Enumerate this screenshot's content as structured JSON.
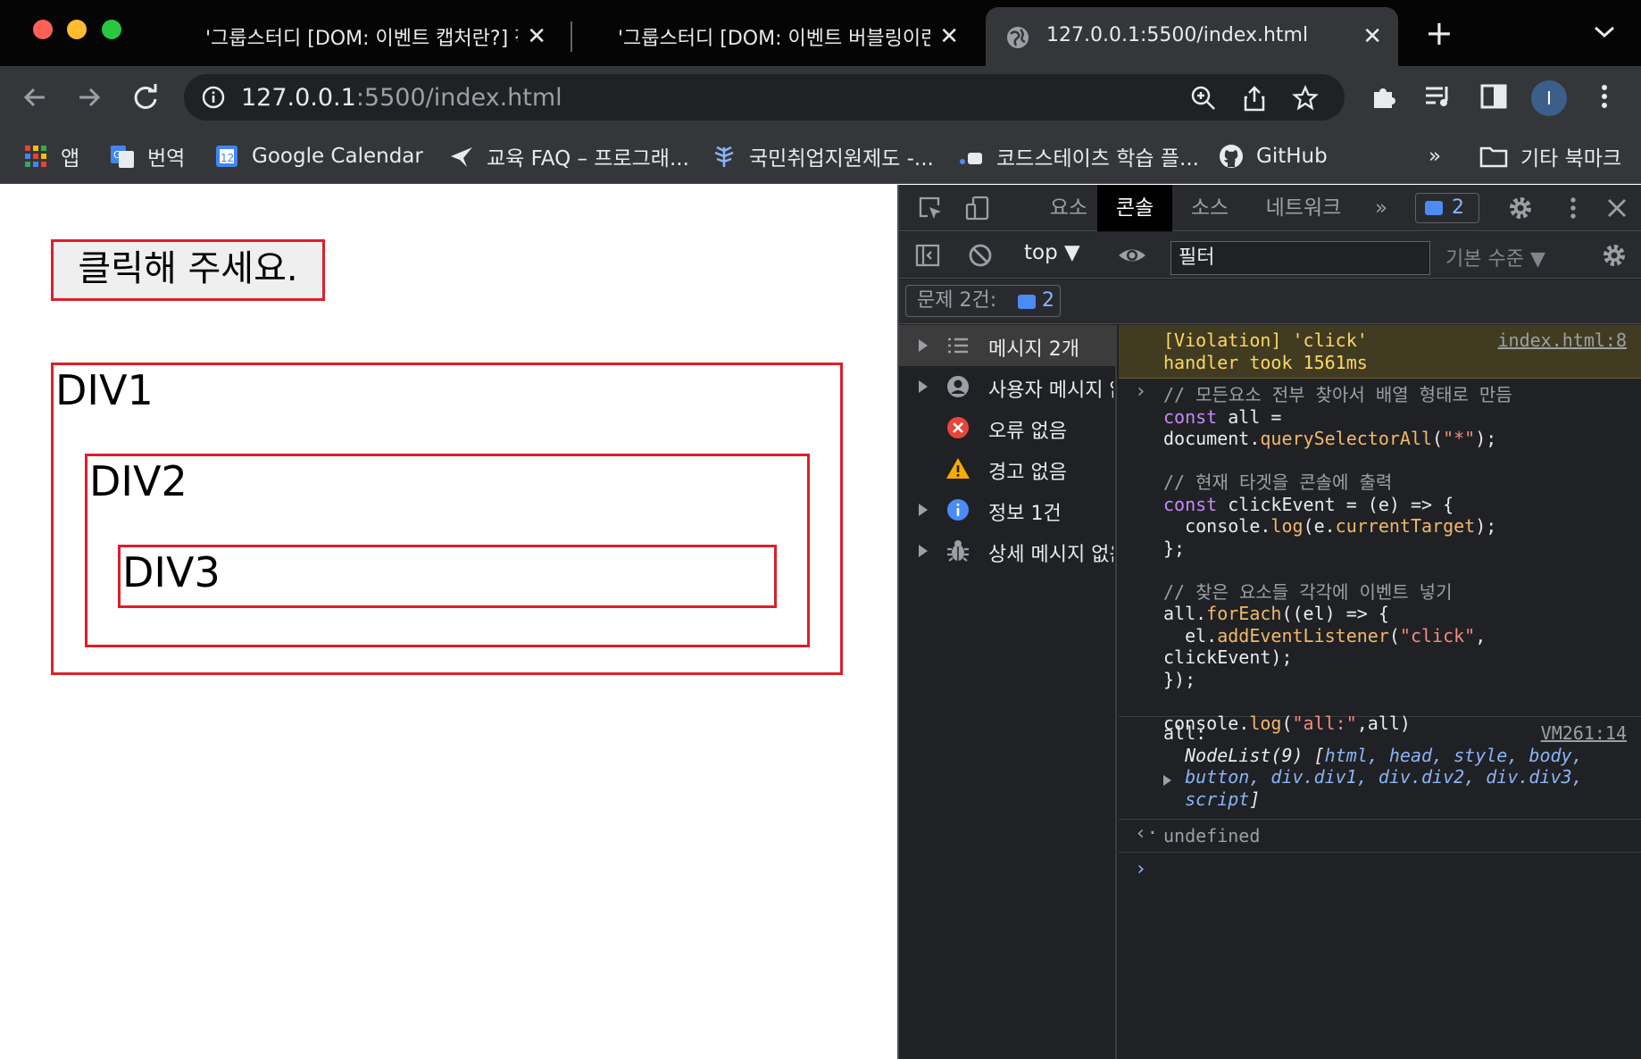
{
  "browser": {
    "tabs": [
      {
        "title": "'그룹스터디 [DOM: 이벤트 캡처란?] 작성",
        "close": "✕"
      },
      {
        "title": "'그룹스터디 [DOM: 이벤트 버블링이란?]",
        "close": "✕"
      },
      {
        "title": "127.0.0.1:5500/index.html",
        "close": "✕"
      }
    ],
    "new_tab": "+",
    "url_host": "127.0.0.1",
    "url_rest": ":5500/index.html",
    "avatar_letter": "I"
  },
  "bookmarks": {
    "items": [
      {
        "label": "앱",
        "icon": "apps-grid-icon"
      },
      {
        "label": "번역",
        "icon": "google-translate-icon"
      },
      {
        "label": "Google Calendar",
        "icon": "google-calendar-icon"
      },
      {
        "label": "교육 FAQ – 프로그래...",
        "icon": "bird-icon"
      },
      {
        "label": "국민취업지원제도 -...",
        "icon": "fern-icon"
      },
      {
        "label": "코드스테이츠 학습 플...",
        "icon": "codestates-icon"
      },
      {
        "label": "GitHub",
        "icon": "github-icon"
      }
    ],
    "overflow": "»",
    "other": "기타 북마크"
  },
  "page": {
    "button_label": "클릭해 주세요.",
    "div1": "DIV1",
    "div2": "DIV2",
    "div3": "DIV3"
  },
  "devtools": {
    "tabs": [
      "요소",
      "콘솔",
      "소스",
      "네트워크"
    ],
    "active_tab": "콘솔",
    "more_tabs": "»",
    "issue_count": "2",
    "context": "top ▼",
    "filter_placeholder": "필터",
    "level": "기본 수준 ▼",
    "issues_label": "문제 2건:",
    "issues_count": "2",
    "sidebar": [
      {
        "label": "메시지 2개",
        "icon": "list-icon",
        "expandable": true
      },
      {
        "label": "사용자 메시지 없음",
        "icon": "user-icon",
        "expandable": true
      },
      {
        "label": "오류 없음",
        "icon": "error-icon",
        "expandable": false
      },
      {
        "label": "경고 없음",
        "icon": "warning-icon",
        "expandable": false
      },
      {
        "label": "정보 1건",
        "icon": "info-icon",
        "expandable": true
      },
      {
        "label": "상세 메시지 없음",
        "icon": "bug-icon",
        "expandable": true
      }
    ],
    "violation": {
      "line1": "[Violation] 'click'",
      "line2": "handler took 1561ms",
      "source": "index.html:8"
    },
    "code": {
      "c1": "// 모든요소 전부 찾아서 배열 형태로 만듬",
      "l2_kw": "const",
      "l2_rest": " all =",
      "l3_obj": "document.",
      "l3_fn": "querySelectorAll",
      "l3_open": "(",
      "l3_str": "\"*\"",
      "l3_close": ");",
      "c2": "// 현재 타겟을 콘솔에 출력",
      "l5_kw": "const",
      "l5_rest": " clickEvent = (e) => {",
      "l6_obj": "  console.",
      "l6_fn": "log",
      "l6_mid": "(e.",
      "l6_prop": "currentTarget",
      "l6_close": ");",
      "l7": "};",
      "c3": "// 찾은 요소들 각각에 이벤트 넣기",
      "l9_obj": "all.",
      "l9_fn": "forEach",
      "l9_rest": "((el) => {",
      "l10_obj": "  el.",
      "l10_fn": "addEventListener",
      "l10_open": "(",
      "l10_str": "\"click\"",
      "l10_close": ",",
      "l11": "clickEvent);",
      "l12": "});",
      "l13_obj": "console.",
      "l13_fn": "log",
      "l13_open": "(",
      "l13_str": "\"all:\"",
      "l13_close": ",all)"
    },
    "log": {
      "label": "all:",
      "source": "VM261:14",
      "line1_pre": "NodeList(9) [",
      "line1_nodes": "html, head, style, body,",
      "line2": "button, div.div1, div.div2, div.div3,",
      "line3": "script",
      "line3_close": "]"
    },
    "result": "undefined",
    "prompt": "›",
    "result_arrow": "‹·"
  }
}
